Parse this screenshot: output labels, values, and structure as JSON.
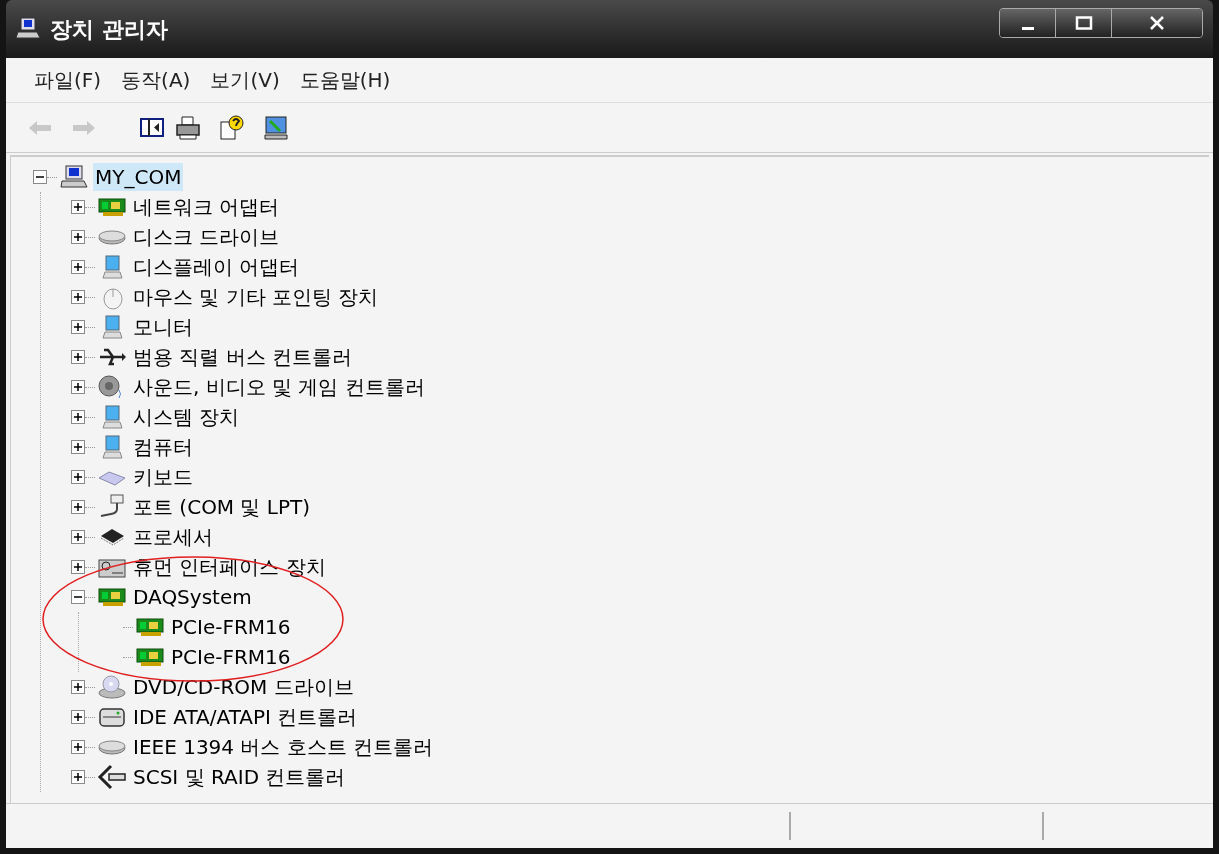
{
  "window": {
    "title": "장치 관리자"
  },
  "menu": [
    "파일(F)",
    "동작(A)",
    "보기(V)",
    "도움말(H)"
  ],
  "toolbar": [
    {
      "kind": "back",
      "disabled": true
    },
    {
      "kind": "forward",
      "disabled": true
    },
    {
      "kind": "tree",
      "disabled": false
    },
    {
      "kind": "print",
      "disabled": false
    },
    {
      "kind": "help",
      "disabled": false
    },
    {
      "kind": "scan",
      "disabled": false
    }
  ],
  "tree": [
    {
      "label": "MY_COM",
      "kind": "computer",
      "selected": true,
      "expanded": true,
      "children": [
        {
          "label": "네트워크 어댑터",
          "kind": "card",
          "selected": false,
          "expanded": false
        },
        {
          "label": "디스크 드라이브",
          "kind": "disk",
          "selected": false,
          "expanded": false
        },
        {
          "label": "디스플레이 어댑터",
          "kind": "monitor",
          "selected": false,
          "expanded": false
        },
        {
          "label": "마우스 및 기타 포인팅 장치",
          "kind": "mouse",
          "selected": false,
          "expanded": false
        },
        {
          "label": "모니터",
          "kind": "monitor",
          "selected": false,
          "expanded": false
        },
        {
          "label": "범용 직렬 버스 컨트롤러",
          "kind": "usb",
          "selected": false,
          "expanded": false
        },
        {
          "label": "사운드, 비디오 및 게임 컨트롤러",
          "kind": "speaker",
          "selected": false,
          "expanded": false
        },
        {
          "label": "시스템 장치",
          "kind": "monitor",
          "selected": false,
          "expanded": false
        },
        {
          "label": "컴퓨터",
          "kind": "monitor",
          "selected": false,
          "expanded": false
        },
        {
          "label": "키보드",
          "kind": "keyboard",
          "selected": false,
          "expanded": false
        },
        {
          "label": "포트 (COM 및 LPT)",
          "kind": "port",
          "selected": false,
          "expanded": false
        },
        {
          "label": "프로세서",
          "kind": "chip",
          "selected": false,
          "expanded": false
        },
        {
          "label": "휴먼 인터페이스 장치",
          "kind": "hid",
          "selected": false,
          "expanded": false
        },
        {
          "label": "DAQSystem",
          "kind": "card",
          "selected": false,
          "expanded": true,
          "children": [
            {
              "label": "PCIe-FRM16",
              "kind": "card",
              "selected": false
            },
            {
              "label": "PCIe-FRM16",
              "kind": "card",
              "selected": false
            }
          ]
        },
        {
          "label": "DVD/CD-ROM 드라이브",
          "kind": "disc",
          "selected": false,
          "expanded": false
        },
        {
          "label": "IDE ATA/ATAPI 컨트롤러",
          "kind": "drive",
          "selected": false,
          "expanded": false
        },
        {
          "label": "IEEE 1394 버스 호스트 컨트롤러",
          "kind": "disk",
          "selected": false,
          "expanded": false
        },
        {
          "label": "SCSI 및 RAID 컨트롤러",
          "kind": "scsi",
          "selected": false,
          "expanded": false
        }
      ]
    }
  ]
}
